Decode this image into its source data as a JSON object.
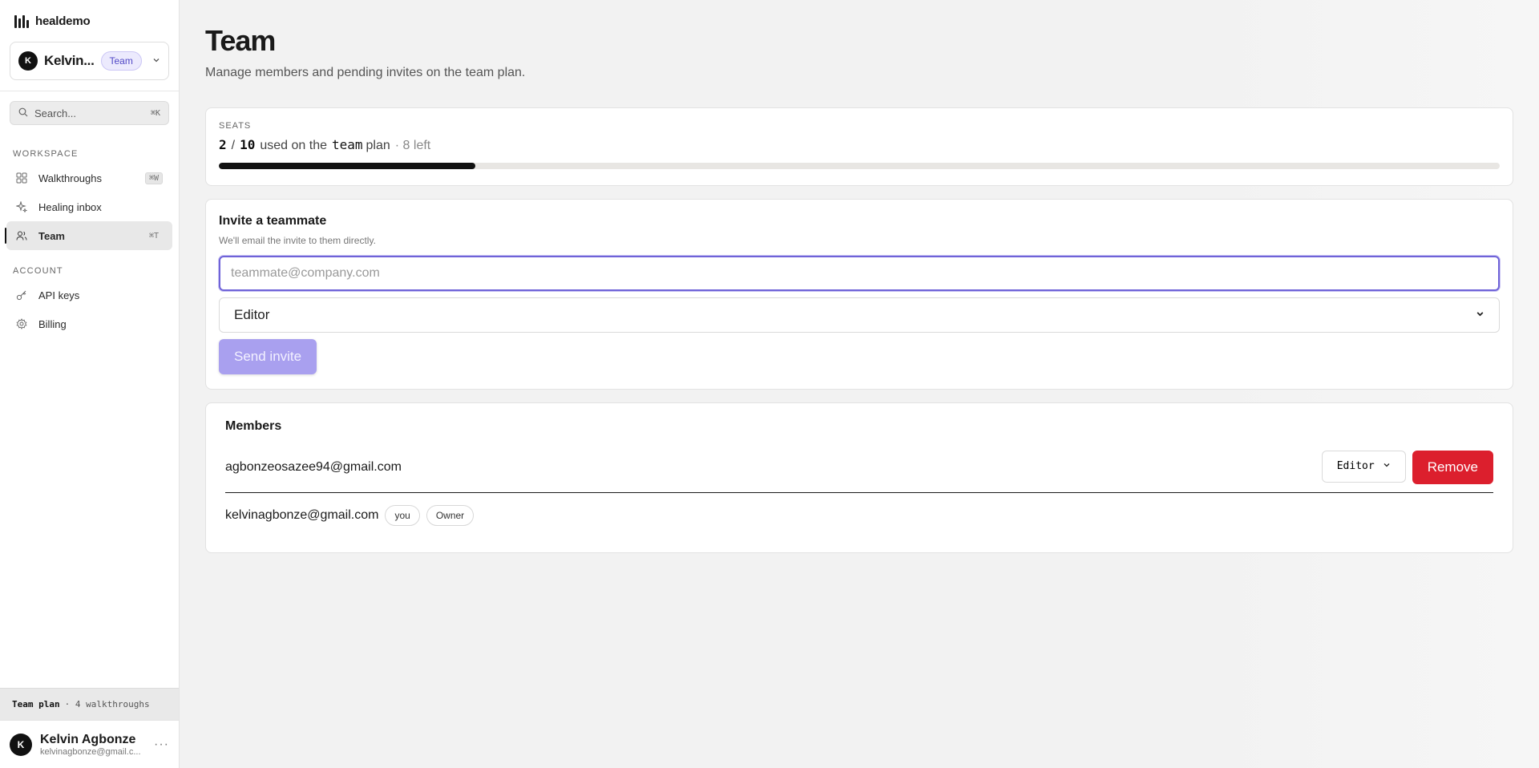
{
  "brand": {
    "name": "healdemo",
    "icon": "bars-logo-icon"
  },
  "workspace": {
    "avatar": "K",
    "name": "Kelvin...",
    "plan_badge": "Team"
  },
  "search": {
    "placeholder": "Search...",
    "shortcut": "⌘K"
  },
  "sidebar": {
    "sections": [
      {
        "label": "WORKSPACE",
        "items": [
          {
            "label": "Walkthroughs",
            "icon": "grid-icon",
            "shortcut": "⌘W",
            "active": false
          },
          {
            "label": "Healing inbox",
            "icon": "sparkle-icon",
            "shortcut": "",
            "active": false
          },
          {
            "label": "Team",
            "icon": "users-icon",
            "shortcut": "⌘T",
            "active": true
          }
        ]
      },
      {
        "label": "ACCOUNT",
        "items": [
          {
            "label": "API keys",
            "icon": "key-icon",
            "shortcut": "",
            "active": false
          },
          {
            "label": "Billing",
            "icon": "gear-icon",
            "shortcut": "",
            "active": false
          }
        ]
      }
    ],
    "plan_strip": {
      "plan": "Team plan",
      "detail": "· 4 walkthroughs"
    },
    "user": {
      "avatar": "K",
      "name": "Kelvin Agbonze",
      "email": "kelvinagbonze@gmail.c..."
    }
  },
  "page": {
    "title": "Team",
    "subtitle": "Manage members and pending invites on the team plan."
  },
  "seats": {
    "label": "SEATS",
    "used": "2",
    "separator": "/",
    "total": "10",
    "text_used_on": "used on the",
    "plan": "team",
    "text_plan": "plan",
    "left": "· 8 left",
    "fraction_used": 0.2
  },
  "invite": {
    "title": "Invite a teammate",
    "subtitle": "We'll email the invite to them directly.",
    "email_placeholder": "teammate@company.com",
    "role_value": "Editor",
    "send_label": "Send invite"
  },
  "members": {
    "title": "Members",
    "rows": [
      {
        "email": "agbonzeosazee94@gmail.com",
        "role": "Editor",
        "remove_label": "Remove"
      },
      {
        "email": "kelvinagbonze@gmail.com",
        "chips": [
          "you",
          "Owner"
        ]
      }
    ]
  },
  "colors": {
    "accent": "#6f63d8",
    "accent_disabled": "#a9a0ef",
    "danger": "#dc1f2d"
  }
}
